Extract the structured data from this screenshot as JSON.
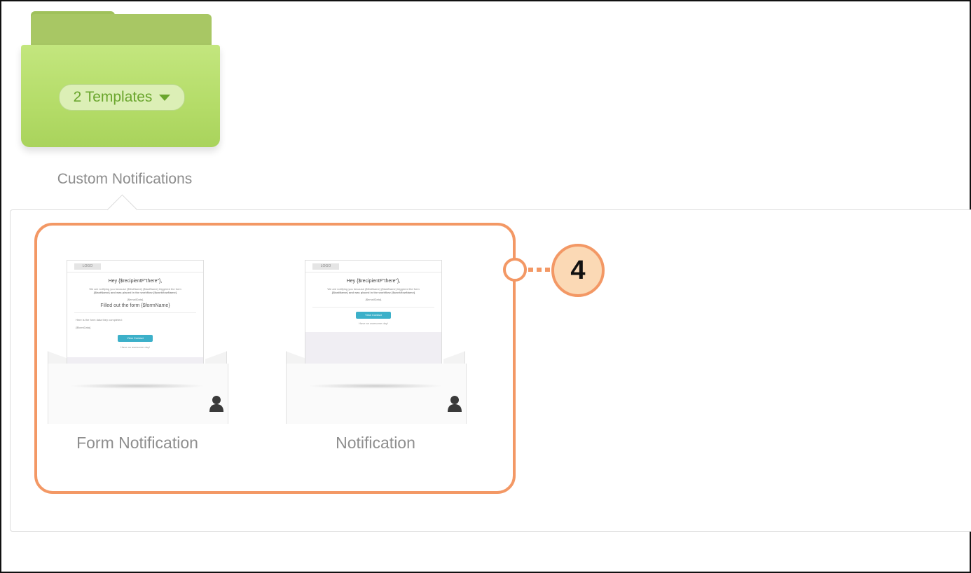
{
  "folder": {
    "count_label": "2 Templates",
    "name": "Custom Notifications",
    "color": "#b4dc68"
  },
  "templates": [
    {
      "title": "Form Notification",
      "preview": {
        "logo": "LOGO",
        "greeting": "Hey {$recipientF\"there\"},",
        "intro_line1": "We are notifying you because {$firstName} {$lastName} triggered the form",
        "intro_line2": "{$lastName} and was placed in the workflow {$workflowName}",
        "email": "{$emailData}",
        "headline": "Filled out the form {$formName}",
        "details_label": "Here is the form data they completed:",
        "form_data": "{$formData}",
        "button": "View Contact",
        "signoff": "Have an awesome day!"
      }
    },
    {
      "title": "Notification",
      "preview": {
        "logo": "LOGO",
        "greeting": "Hey {$recipientF\"there\"},",
        "intro_line1": "We are notifying you because {$firstName} {$lastName} triggered the form",
        "intro_line2": "{$lastName} and was placed in the workflow {$workflowName}",
        "email": "{$emailData}",
        "button": "View Contact",
        "signoff": "Have an awesome day!"
      }
    }
  ],
  "callout": {
    "step_number": "4",
    "accent_color": "#f39865"
  },
  "icons": {
    "dropdown": "caret-down-icon",
    "owner": "person-icon"
  }
}
